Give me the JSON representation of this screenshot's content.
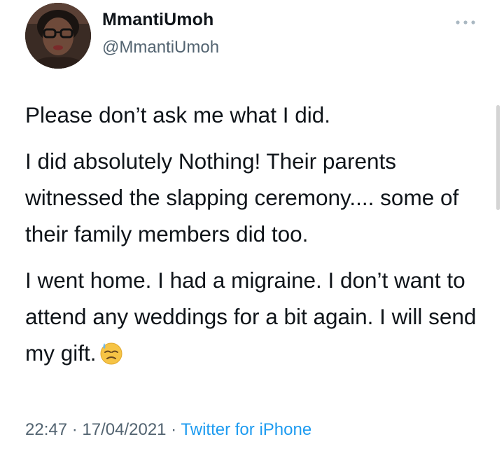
{
  "author": {
    "display_name": "MmantiUmoh",
    "handle": "@MmantiUmoh",
    "avatar_icon": "profile-photo"
  },
  "menu_icon": "more-options-icon",
  "paragraphs": [
    "Please don’t ask me what I did.",
    "I did absolutely Nothing! Their parents witnessed the slapping ceremony.... some of their family members did too.",
    "I went home. I had a migraine. I don’t want to attend any weddings for a bit again. I will send my gift."
  ],
  "emoji": "downcast-face-with-sweat-icon",
  "meta": {
    "time": "22:47",
    "separator": " · ",
    "date": "17/04/2021",
    "source": "Twitter for iPhone"
  },
  "colors": {
    "text": "#0f1419",
    "secondary": "#536471",
    "link": "#1d9bf0"
  }
}
